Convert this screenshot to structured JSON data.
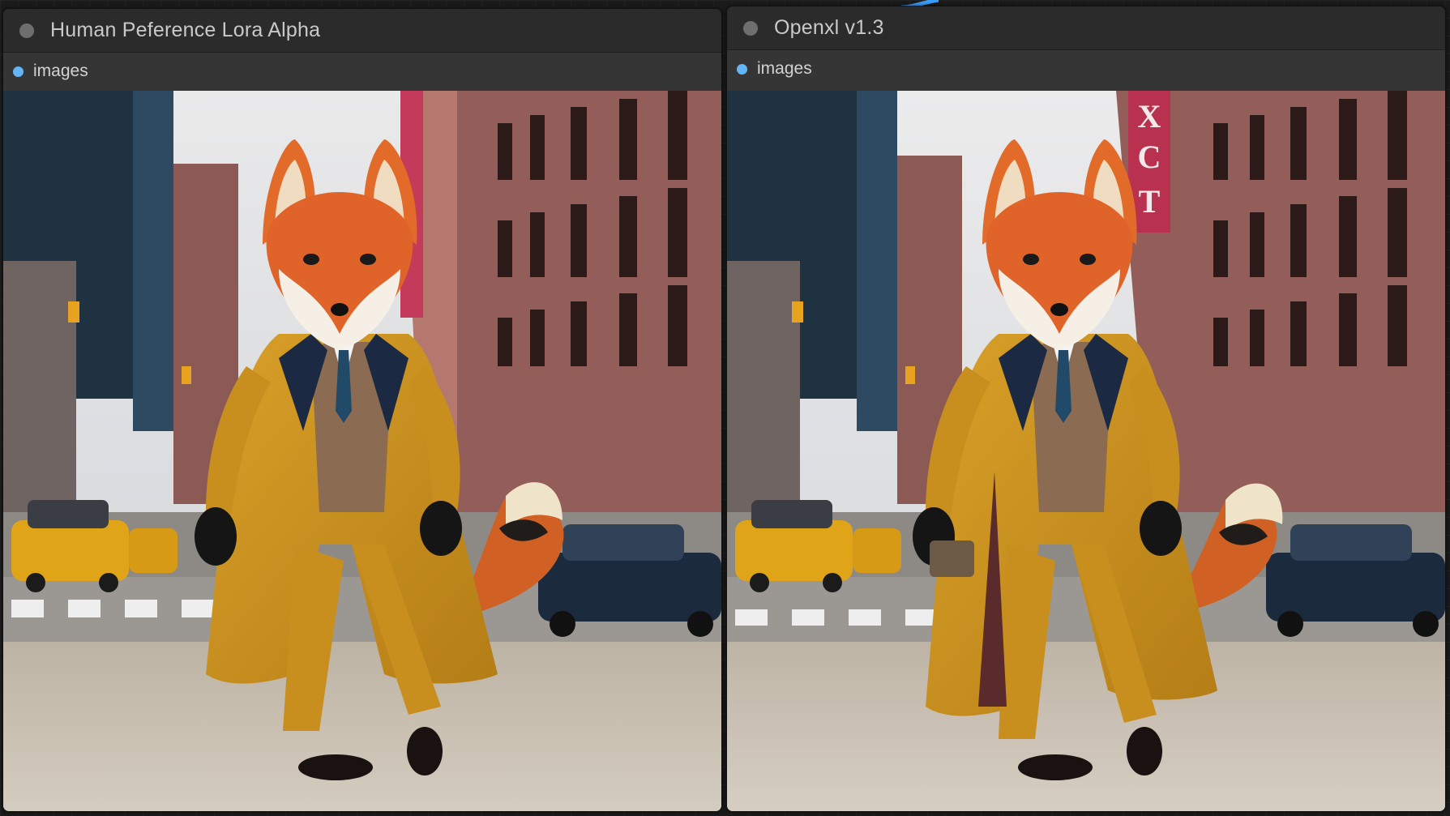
{
  "nodes": [
    {
      "title": "Human Peference Lora Alpha",
      "output_slot": "images",
      "sign_text": ""
    },
    {
      "title": "Openxl v1.3",
      "output_slot": "images",
      "sign_text": "XCT"
    }
  ],
  "colors": {
    "canvas_bg": "#1b1b1b",
    "node_bg": "#353535",
    "node_header_bg": "#2b2b2b",
    "slot_dot": "#64b5f6",
    "wire": "#3aa0ff"
  },
  "icons": {
    "collapse": "grey-circle-icon",
    "output_slot": "blue-dot-icon"
  }
}
